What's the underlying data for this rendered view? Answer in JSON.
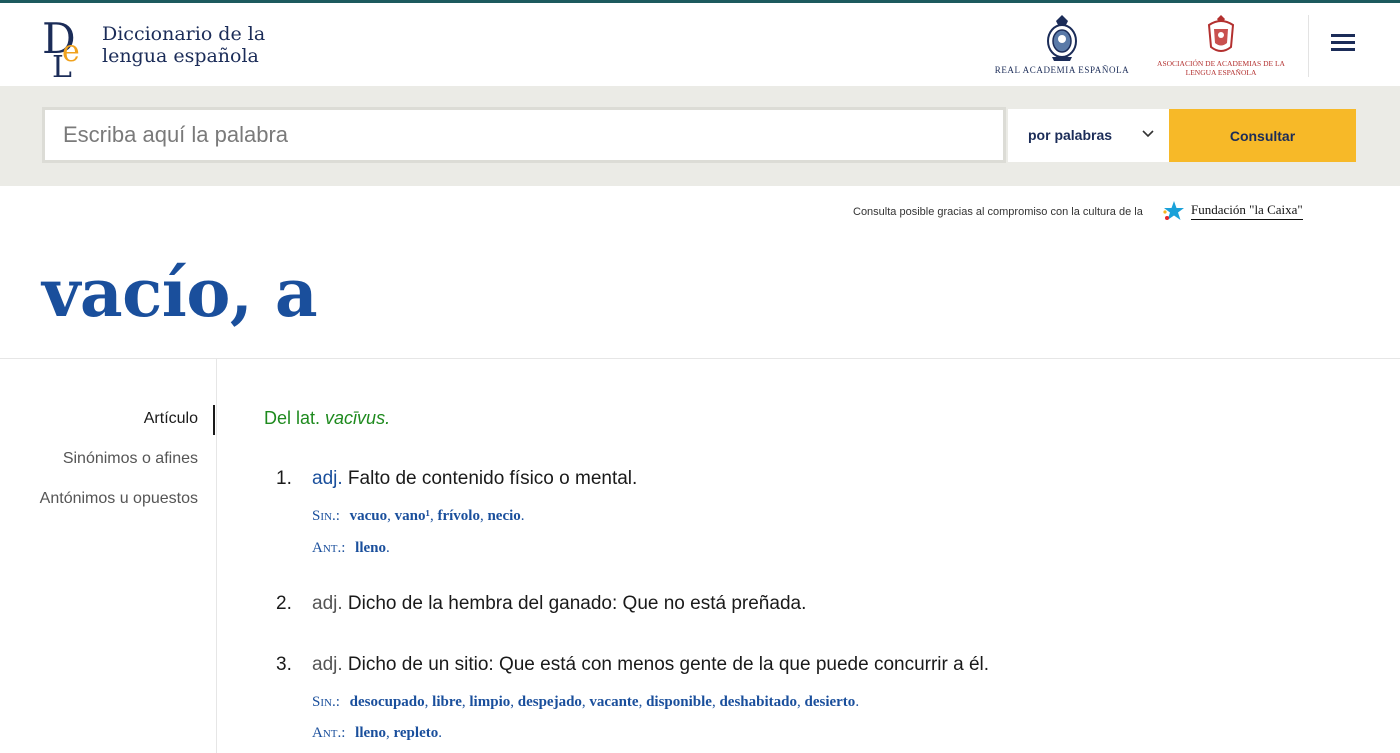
{
  "header": {
    "logo_line1": "Diccionario de la",
    "logo_line2": "lengua española",
    "rae_label": "REAL ACADEMIA ESPAÑOLA",
    "asale_line1": "ASOCIACIÓN DE ACADEMIAS DE LA",
    "asale_line2": "LENGUA ESPAÑOLA"
  },
  "search": {
    "placeholder": "Escriba aquí la palabra",
    "mode_label": "por palabras",
    "consult_label": "Consultar"
  },
  "sponsor": {
    "text": "Consulta posible gracias al compromiso con la cultura de la",
    "name": "Fundación \"la Caixa\""
  },
  "entry": {
    "headword": "vacío, a",
    "etymology_prefix": "Del lat.",
    "etymology_word": "vacīvus."
  },
  "sidebar": {
    "items": [
      "Artículo",
      "Sinónimos o afines",
      "Antónimos u opuestos"
    ]
  },
  "senses": {
    "s1": {
      "num": "1.",
      "abbr": "adj.",
      "def": "Falto de contenido físico o mental.",
      "sin_label": "Sin.:",
      "sin": [
        "vacuo",
        "vano¹",
        "frívolo",
        "necio"
      ],
      "ant_label": "Ant.:",
      "ant": [
        "lleno"
      ]
    },
    "s2": {
      "num": "2.",
      "abbr": "adj.",
      "def": "Dicho de la hembra del ganado: Que no está preñada."
    },
    "s3": {
      "num": "3.",
      "abbr": "adj.",
      "def": "Dicho de un sitio: Que está con menos gente de la que puede concurrir a él.",
      "sin_label": "Sin.:",
      "sin": [
        "desocupado",
        "libre",
        "limpio",
        "despejado",
        "vacante",
        "disponible",
        "deshabitado",
        "desierto"
      ],
      "ant_label": "Ant.:",
      "ant": [
        "lleno",
        "repleto"
      ]
    }
  },
  "colors": {
    "accent_blue": "#1a4f9c",
    "navy": "#1b2c58",
    "button_yellow": "#f7b928",
    "etymology_green": "#1e8a1e"
  },
  "icons": {
    "menu": "hamburger-icon",
    "dropdown": "chevron-down-icon",
    "rae": "rae-crest-icon",
    "asale": "asale-crest-icon",
    "caixa": "caixa-star-icon"
  }
}
